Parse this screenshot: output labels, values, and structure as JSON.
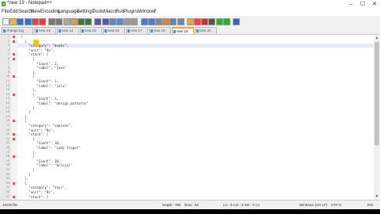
{
  "window": {
    "title": "*new 19 - Notepad++",
    "minimize": "–",
    "maximize": "☐",
    "close": "✕"
  },
  "menu": [
    "File",
    "Edit",
    "Search",
    "View",
    "Encoding",
    "Language",
    "Settings",
    "Tools",
    "Macro",
    "Run",
    "Plugins",
    "Window",
    "?"
  ],
  "toolbar_icons": [
    {
      "name": "new-file-icon",
      "color": "#f2f2f2"
    },
    {
      "name": "open-file-icon",
      "color": "#e8b84a"
    },
    {
      "name": "save-icon",
      "color": "#3b6fc7"
    },
    {
      "name": "save-all-icon",
      "color": "#3b6fc7"
    },
    {
      "name": "close-icon",
      "color": "#d44"
    },
    {
      "name": "close-all-icon",
      "color": "#d44"
    },
    {
      "name": "print-icon",
      "color": "#777"
    },
    {
      "name": "cut-icon",
      "color": "#777"
    },
    {
      "name": "copy-icon",
      "color": "#aaa"
    },
    {
      "name": "paste-icon",
      "color": "#c9a060"
    },
    {
      "name": "undo-icon",
      "color": "#3a7a3a"
    },
    {
      "name": "redo-icon",
      "color": "#3a7a3a"
    },
    {
      "name": "find-icon",
      "color": "#5a5a9a"
    },
    {
      "name": "replace-icon",
      "color": "#5a5a9a"
    },
    {
      "name": "zoom-in-icon",
      "color": "#5a8ac8"
    },
    {
      "name": "zoom-out-icon",
      "color": "#5a8ac8"
    },
    {
      "name": "sync-v-icon",
      "color": "#999"
    },
    {
      "name": "sync-h-icon",
      "color": "#999"
    },
    {
      "name": "wrap-icon",
      "color": "#4a7ad0"
    },
    {
      "name": "all-chars-icon",
      "color": "#4a7ad0"
    },
    {
      "name": "indent-guide-icon",
      "color": "#888"
    },
    {
      "name": "udl-icon",
      "color": "#c84"
    },
    {
      "name": "doc-map-icon",
      "color": "#68a"
    },
    {
      "name": "function-list-icon",
      "color": "#68a"
    },
    {
      "name": "folder-workspace-icon",
      "color": "#da4"
    },
    {
      "name": "monitor-icon",
      "color": "#e44"
    },
    {
      "name": "record-macro-icon",
      "color": "#c33"
    },
    {
      "name": "stop-macro-icon",
      "color": "#555"
    },
    {
      "name": "play-macro-icon",
      "color": "#3a3"
    },
    {
      "name": "run-macro-multiple-icon",
      "color": "#3a3"
    },
    {
      "name": "save-macro-icon",
      "color": "#36c"
    }
  ],
  "tabs": [
    {
      "label": "change.log",
      "active": false
    },
    {
      "label": "new 13",
      "active": false
    },
    {
      "label": "new 14",
      "active": false
    },
    {
      "label": "new 15",
      "active": false
    },
    {
      "label": "new 16",
      "active": false
    },
    {
      "label": "new 17",
      "active": false
    },
    {
      "label": "new 18",
      "active": false
    },
    {
      "label": "new 19",
      "active": true
    },
    {
      "label": "new 20",
      "active": false
    }
  ],
  "code_lines": [
    {
      "n": "1",
      "text": "[",
      "fold": true
    },
    {
      "n": "2",
      "text": "  {",
      "fold": true
    },
    {
      "n": "3",
      "text": "    \"category\": \"books\",",
      "hl": true
    },
    {
      "n": "4",
      "text": "    \"unit\": \"Rs\","
    },
    {
      "n": "5",
      "text": "    \"stock\": [",
      "fold": true
    },
    {
      "n": "6",
      "text": "      {",
      "fold": true
    },
    {
      "n": "7",
      "text": "        \"Count\": 2,"
    },
    {
      "n": "8",
      "text": "        \"label\": \"java\""
    },
    {
      "n": "9",
      "text": "      },"
    },
    {
      "n": "10",
      "text": "      {",
      "fold": true
    },
    {
      "n": "11",
      "text": "        \"Count\": 1,"
    },
    {
      "n": "12",
      "text": "        \"label\": \"sola\""
    },
    {
      "n": "13",
      "text": "      },"
    },
    {
      "n": "14",
      "text": "      {",
      "fold": true
    },
    {
      "n": "15",
      "text": "        \"Count\": 1,"
    },
    {
      "n": "16",
      "text": "        \"label\": \"design patterns\""
    },
    {
      "n": "17",
      "text": "      }"
    },
    {
      "n": "18",
      "text": "    ]"
    },
    {
      "n": "19",
      "text": "  },"
    },
    {
      "n": "20",
      "text": "  {",
      "fold": true
    },
    {
      "n": "21",
      "text": "    \"category\": \"sapiens\","
    },
    {
      "n": "22",
      "text": "    \"unit\": \"Rs\","
    },
    {
      "n": "23",
      "text": "    \"stock\": [",
      "fold": true
    },
    {
      "n": "24",
      "text": "      {",
      "fold": true
    },
    {
      "n": "25",
      "text": "        \"Count\": 10,"
    },
    {
      "n": "26",
      "text": "        \"label\": \"Lady finger\""
    },
    {
      "n": "27",
      "text": "      },"
    },
    {
      "n": "28",
      "text": "      {",
      "fold": true
    },
    {
      "n": "29",
      "text": "        \"Count\": 30,"
    },
    {
      "n": "30",
      "text": "        \"label\": \"brinjal\""
    },
    {
      "n": "31",
      "text": "      }"
    },
    {
      "n": "32",
      "text": "    ]"
    },
    {
      "n": "33",
      "text": "  },"
    },
    {
      "n": "34",
      "text": "  {",
      "fold": true
    },
    {
      "n": "35",
      "text": "    \"category\": \"toys\","
    },
    {
      "n": "36",
      "text": "    \"unit\": \"Rs\","
    },
    {
      "n": "37",
      "text": "    \"stock\": [",
      "fold": true
    }
  ],
  "status": {
    "filetype": "JSON file",
    "length": "length : 780",
    "lines": "lines : 52",
    "position": "Ln : 3    Col : 8    Sel : 0 | 0",
    "eol": "Windows (CR LF)",
    "encoding": "UTF-8",
    "mode": "INS"
  }
}
